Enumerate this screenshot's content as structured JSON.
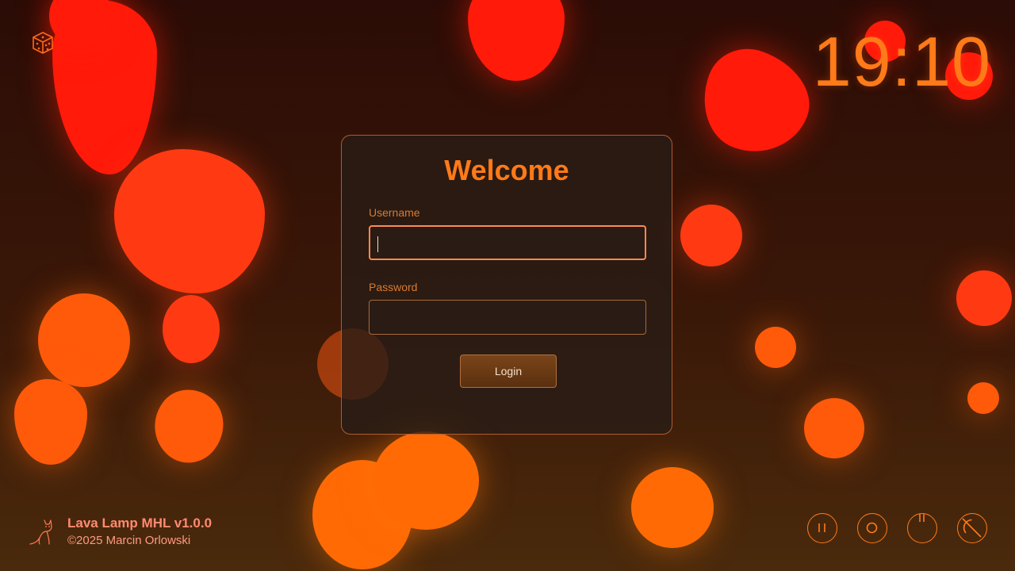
{
  "clock": {
    "time": "19:10"
  },
  "login": {
    "title": "Welcome",
    "username_label": "Username",
    "username_value": "",
    "password_label": "Password",
    "password_value": "",
    "button_label": "Login"
  },
  "footer": {
    "app_name": "Lava Lamp MHL v1.0.0",
    "copyright": "©2025 Marcin Orlowski"
  },
  "icons": {
    "top_left": "dice-icon",
    "footer_logo": "cat-icon",
    "controls": [
      "pause-icon",
      "stop-icon",
      "power-icon",
      "reboot-icon"
    ]
  },
  "colors": {
    "accent": "#ff7a18",
    "blob_red": "#ff1a0a",
    "blob_orange": "#ff5a0a",
    "panel_border": "#e6783c"
  }
}
